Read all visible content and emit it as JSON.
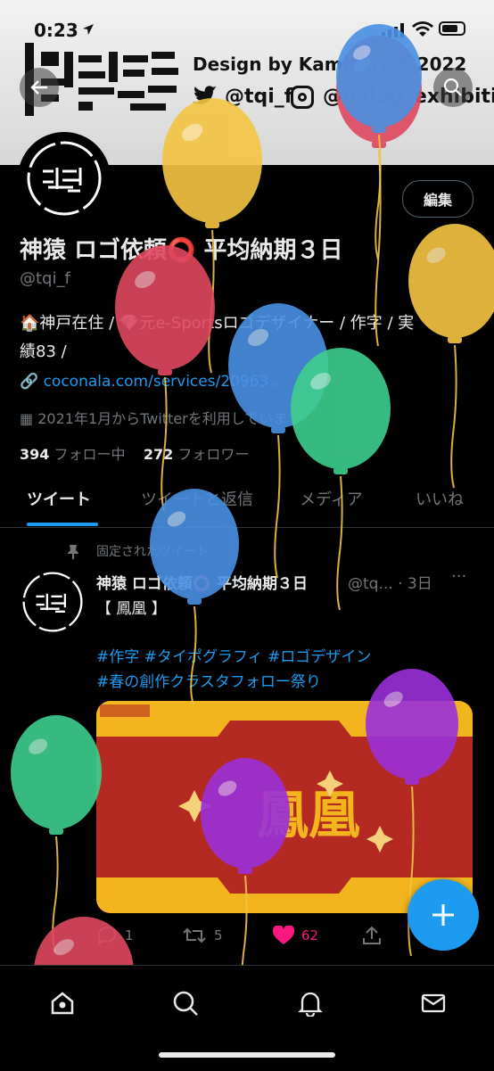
{
  "status_bar": {
    "time": "0:23"
  },
  "banner": {
    "line1": "Design by Kamizaru® 2022",
    "line2": "@tqi_f",
    "line3": "@nalog_exhibition"
  },
  "profile": {
    "edit_label": "編集",
    "name": "神猿 ロゴ依頼⭕ 平均納期３日",
    "handle": "@tqi_f",
    "bio_line1": "🏠神戸在住 / 💎元e-Sportsロゴデザイナー / 作字 / 実",
    "bio_line2": "績83 /",
    "link": "coconala.com/services/20963...",
    "joined": "2021年1月からTwitterを利用しています",
    "following_count": "394",
    "following_label": "フォロー中",
    "followers_count": "272",
    "followers_label": "フォロワー"
  },
  "tabs": [
    "ツイート",
    "ツイートと返信",
    "メディア",
    "いいね"
  ],
  "tweet": {
    "pinned_label": "固定されたツイート",
    "name": "神猿 ロゴ依頼⭕ 平均納期３日",
    "handle_time": "@tq... · 3日",
    "more": "···",
    "text": "【 鳳凰 】",
    "hashtags_line1": "#作字 #タイポグラフィ #ロゴデザイン",
    "hashtags_line2": "#春の創作クラスタフォロー祭り",
    "image_text": "鳳凰",
    "reply_count": "1",
    "retweet_count": "5",
    "like_count": "62"
  },
  "colors": {
    "accent": "#1d9bf0",
    "like": "#f91880",
    "balloon_red": "#e0485e",
    "balloon_blue": "#4a90e2",
    "balloon_yellow": "#f5c542",
    "balloon_green": "#3ecf8e",
    "balloon_purple": "#9b30d9"
  },
  "icons": {
    "back": "back-arrow-icon",
    "search": "search-icon",
    "fab": "compose-plus-icon",
    "nav": [
      "home-icon",
      "search-icon",
      "bell-icon",
      "mail-icon"
    ]
  }
}
